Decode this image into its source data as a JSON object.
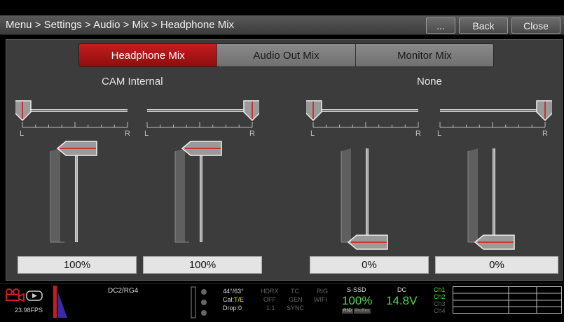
{
  "header": {
    "breadcrumb": "Menu > Settings > Audio > Mix > Headphone Mix",
    "more_label": "...",
    "back_label": "Back",
    "close_label": "Close"
  },
  "tabs": [
    {
      "label": "Headphone Mix",
      "active": true
    },
    {
      "label": "Audio Out Mix",
      "active": false
    },
    {
      "label": "Monitor Mix",
      "active": false
    }
  ],
  "groups": [
    {
      "label": "CAM Internal",
      "channels": [
        {
          "pan_left": "L",
          "pan_right": "R",
          "pan_position": 0.0,
          "level_fraction": 1.0,
          "level_text": "100%"
        },
        {
          "pan_left": "L",
          "pan_right": "R",
          "pan_position": 1.0,
          "level_fraction": 1.0,
          "level_text": "100%"
        }
      ]
    },
    {
      "label": "None",
      "channels": [
        {
          "pan_left": "L",
          "pan_right": "R",
          "pan_position": 0.0,
          "level_fraction": 0.0,
          "level_text": "0%"
        },
        {
          "pan_left": "L",
          "pan_right": "R",
          "pan_position": 1.0,
          "level_fraction": 0.0,
          "level_text": "0%"
        }
      ]
    }
  ],
  "status": {
    "fps": "23.98FPS",
    "preset": "DC2/RG4",
    "temps": "44°/63°",
    "cal_prefix": "Cal:",
    "cal_value": "T/E",
    "drop": "Drop:0",
    "hdrx": "HDRX",
    "hdrx_val": "OFF",
    "ratio": "1:1",
    "tc": "TC",
    "tc_val": "GEN",
    "sync": "SYNC",
    "rig": "RIG",
    "wifi": "WIFI",
    "media_label": "S-SSD",
    "media_value": "100%",
    "media_tag1": "R3D",
    "media_tag2": "ProRes",
    "power_label": "DC",
    "power_value": "14.8V",
    "channels": [
      "Ch1",
      "Ch2",
      "Ch3",
      "Ch4"
    ],
    "colors": {
      "accent": "#c41e1e",
      "green": "#4cd94c",
      "yellow": "#e6e600"
    }
  }
}
